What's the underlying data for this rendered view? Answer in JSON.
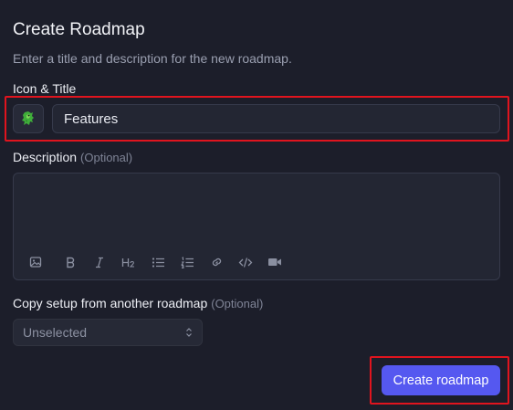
{
  "dialog": {
    "title": "Create Roadmap",
    "subtitle": "Enter a title and description for the new roadmap."
  },
  "icon_title": {
    "label": "Icon & Title",
    "icon": "dragon-emoji",
    "value": "Features"
  },
  "description": {
    "label": "Description",
    "optional": "(Optional)",
    "value": "",
    "toolbar": [
      "image-icon",
      "bold-icon",
      "italic-icon",
      "heading2-icon",
      "bullet-list-icon",
      "numbered-list-icon",
      "link-icon",
      "code-icon",
      "video-icon"
    ]
  },
  "copy_setup": {
    "label": "Copy setup from another roadmap",
    "optional": "(Optional)",
    "selected": "Unselected"
  },
  "actions": {
    "create_label": "Create roadmap"
  },
  "colors": {
    "background": "#1c1e2a",
    "accent": "#5558f0",
    "highlight": "#e0141e"
  }
}
